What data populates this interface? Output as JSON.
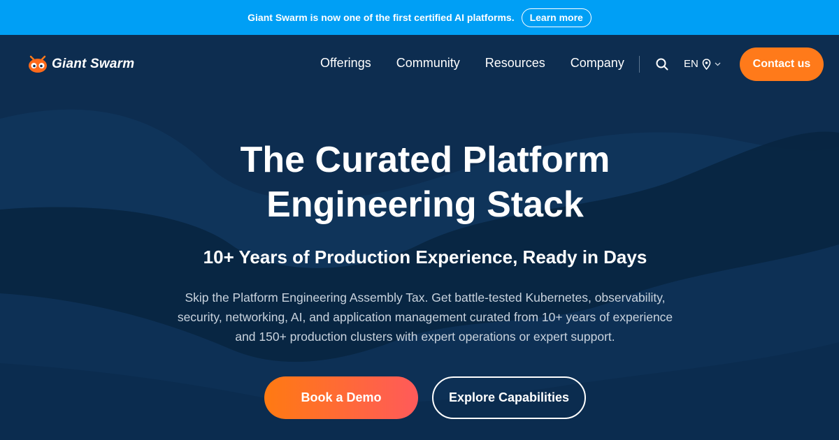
{
  "banner": {
    "text": "Giant Swarm is now one of the first certified AI platforms.",
    "button_label": "Learn more"
  },
  "nav": {
    "logo_text": "Giant Swarm",
    "logo_icon": "ant-icon",
    "items": [
      {
        "label": "Offerings"
      },
      {
        "label": "Community"
      },
      {
        "label": "Resources"
      },
      {
        "label": "Company"
      }
    ],
    "search_icon": "search-icon",
    "language": "EN",
    "location_icon": "location-pin-icon",
    "chevron_icon": "chevron-down-icon",
    "contact_label": "Contact us"
  },
  "hero": {
    "title_line1": "The Curated Platform",
    "title_line2": "Engineering Stack",
    "subtitle": "10+ Years of Production Experience, Ready in Days",
    "description_line1": "Skip the Platform Engineering Assembly Tax. Get battle-tested Kubernetes, observability,",
    "description_line2": "security, networking, AI, and application management curated from 10+ years of experience",
    "description_line3": "and 150+ production clusters with expert operations or expert support.",
    "primary_button": "Book a Demo",
    "secondary_button": "Explore Capabilities"
  },
  "colors": {
    "banner_bg": "#009ff5",
    "hero_bg": "#0d2d50",
    "accent_orange": "#ff7a1a",
    "accent_coral": "#ff5a5a"
  }
}
